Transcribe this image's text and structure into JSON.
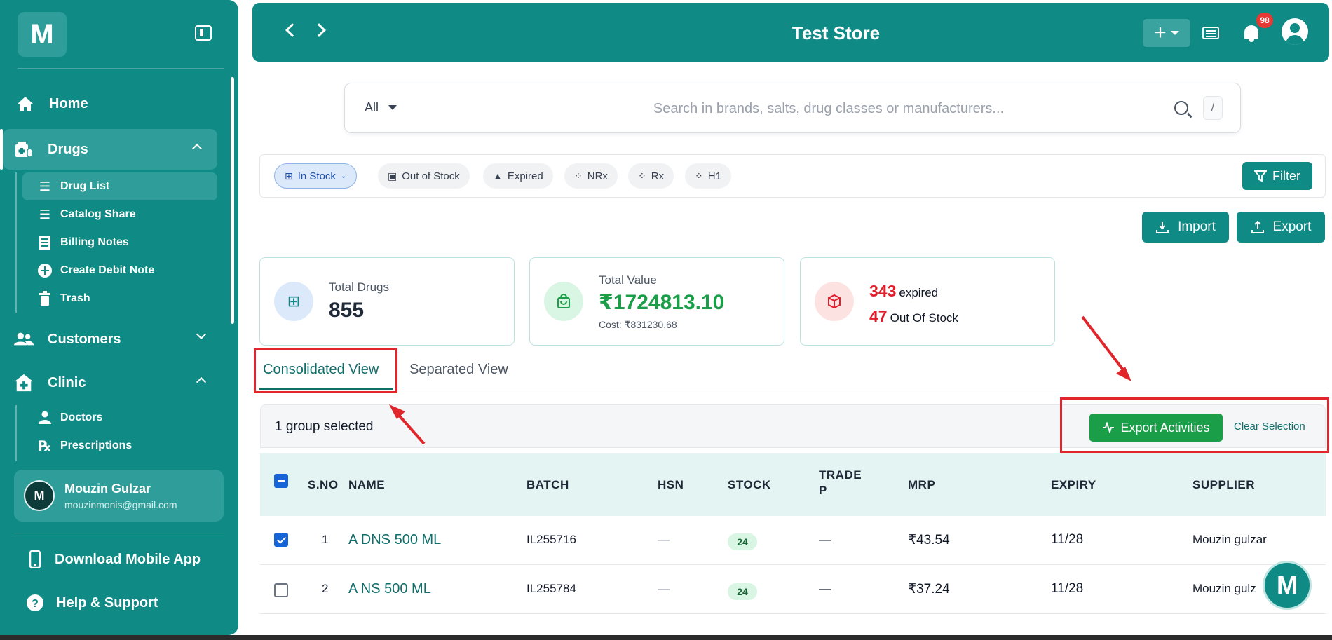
{
  "sidebar": {
    "logo_letter": "M",
    "nav": {
      "home": "Home",
      "drugs": "Drugs",
      "customers": "Customers",
      "clinic": "Clinic"
    },
    "drugs_sub": [
      "Drug List",
      "Catalog Share",
      "Billing Notes",
      "Create Debit Note",
      "Trash"
    ],
    "clinic_sub": [
      "Doctors",
      "Prescriptions"
    ],
    "user": {
      "initial": "M",
      "name": "Mouzin Gulzar",
      "email": "mouzinmonis@gmail.com"
    },
    "download_app": "Download Mobile App",
    "help": "Help & Support"
  },
  "header": {
    "title": "Test Store",
    "notifications": "98"
  },
  "search": {
    "scope": "All",
    "placeholder": "Search in brands, salts, drug classes or manufacturers...",
    "shortcut": "/"
  },
  "filters": {
    "chips": [
      "In Stock",
      "Out of Stock",
      "Expired",
      "NRx",
      "Rx",
      "H1"
    ],
    "filter_label": "Filter"
  },
  "actions": {
    "import": "Import",
    "export": "Export"
  },
  "stats": {
    "total_drugs_label": "Total Drugs",
    "total_drugs": "855",
    "total_value_label": "Total Value",
    "total_value": "₹1724813.10",
    "cost": "Cost: ₹831230.68",
    "expired_count": "343",
    "expired_label": "expired",
    "oos_count": "47",
    "oos_label": "Out Of Stock"
  },
  "tabs": {
    "consolidated": "Consolidated View",
    "separated": "Separated View"
  },
  "selection": {
    "text": "1 group selected",
    "export_activities": "Export Activities",
    "clear": "Clear Selection"
  },
  "table": {
    "headers": {
      "sno": "S.NO",
      "name": "NAME",
      "batch": "BATCH",
      "hsn": "HSN",
      "stock": "STOCK",
      "trade_1": "TRADE",
      "trade_2": "P",
      "mrp": "MRP",
      "expiry": "EXPIRY",
      "supplier": "SUPPLIER"
    },
    "rows": [
      {
        "sno": "1",
        "name": "A DNS 500 ML",
        "batch": "IL255716",
        "hsn": "—",
        "stock": "24",
        "trade": "—",
        "mrp": "₹43.54",
        "expiry": "11/28",
        "supplier": "Mouzin gulzar"
      },
      {
        "sno": "2",
        "name": "A NS 500 ML",
        "batch": "IL255784",
        "hsn": "—",
        "stock": "24",
        "trade": "—",
        "mrp": "₹37.24",
        "expiry": "11/28",
        "supplier": "Mouzin gulz"
      }
    ]
  },
  "colors": {
    "primary": "#0f8a85",
    "accent_red": "#e0252b",
    "green": "#1a9e48"
  }
}
